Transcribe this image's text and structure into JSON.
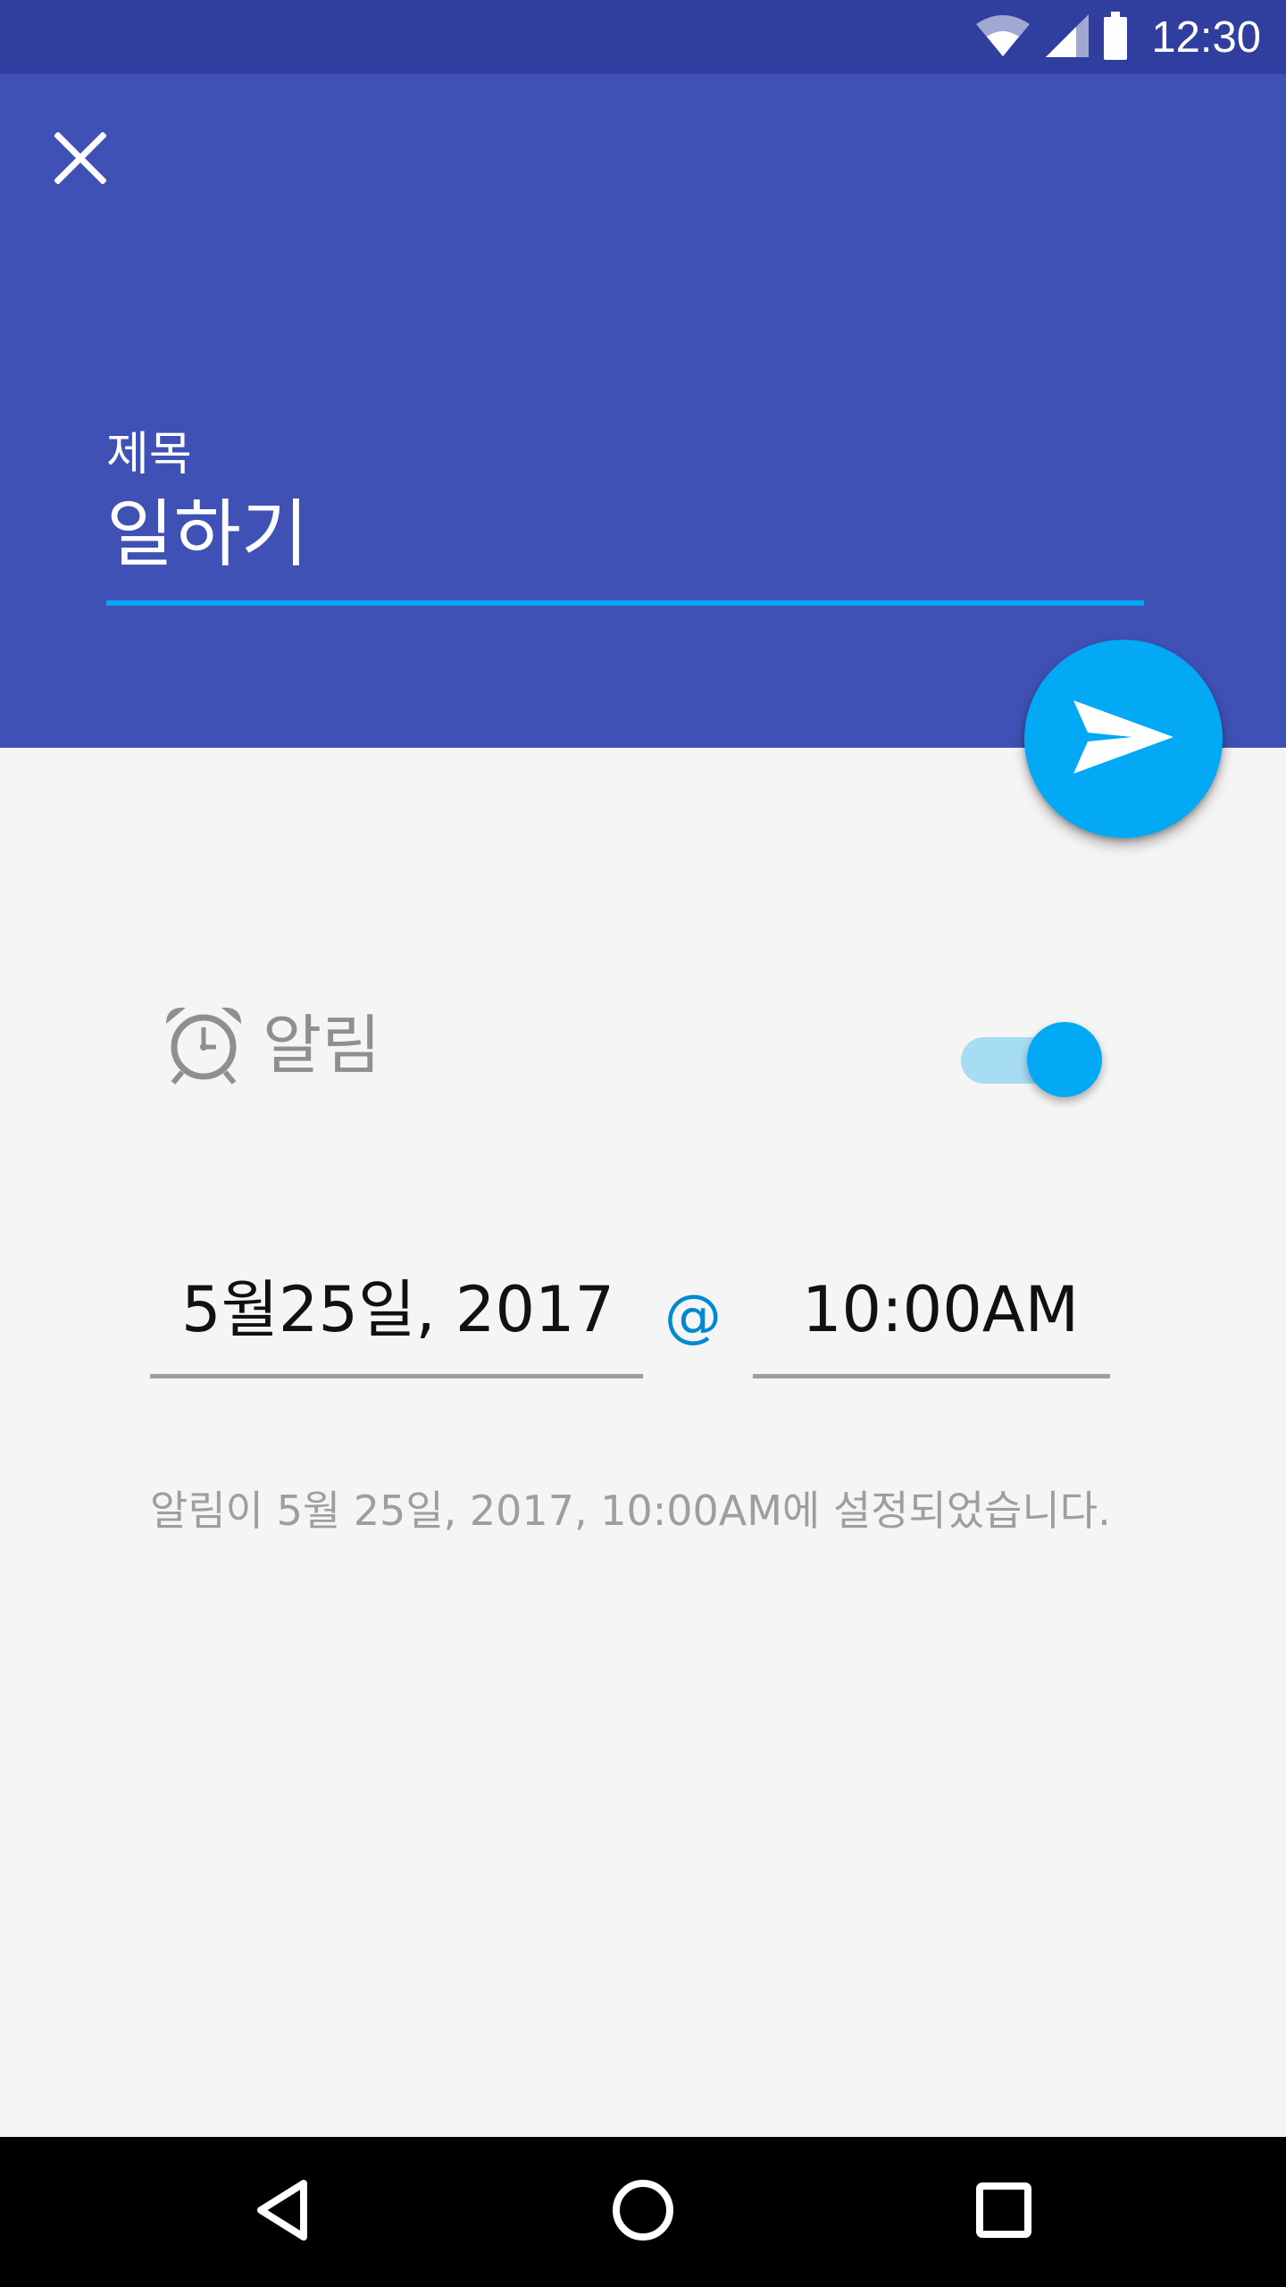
{
  "status_bar": {
    "time": "12:30",
    "icons": [
      "wifi-icon",
      "signal-icon",
      "battery-icon"
    ]
  },
  "header": {
    "close_icon": "close-icon",
    "title_label": "제목",
    "title_value": "일하기",
    "send_icon": "send-icon"
  },
  "alarm": {
    "icon": "alarm-clock-icon",
    "label": "알림",
    "enabled": true
  },
  "schedule": {
    "date": "5월25일, 2017",
    "separator": "@",
    "time": "10:00AM",
    "info": "알림이 5월 25일, 2017, 10:00AM에 설정되었습니다."
  },
  "nav": {
    "back_icon": "back-icon",
    "home_icon": "home-icon",
    "recents_icon": "recents-icon"
  },
  "colors": {
    "status_bar": "#303f9f",
    "app_bar": "#3f51b5",
    "accent": "#03a9f4",
    "background": "#f5f5f5"
  }
}
